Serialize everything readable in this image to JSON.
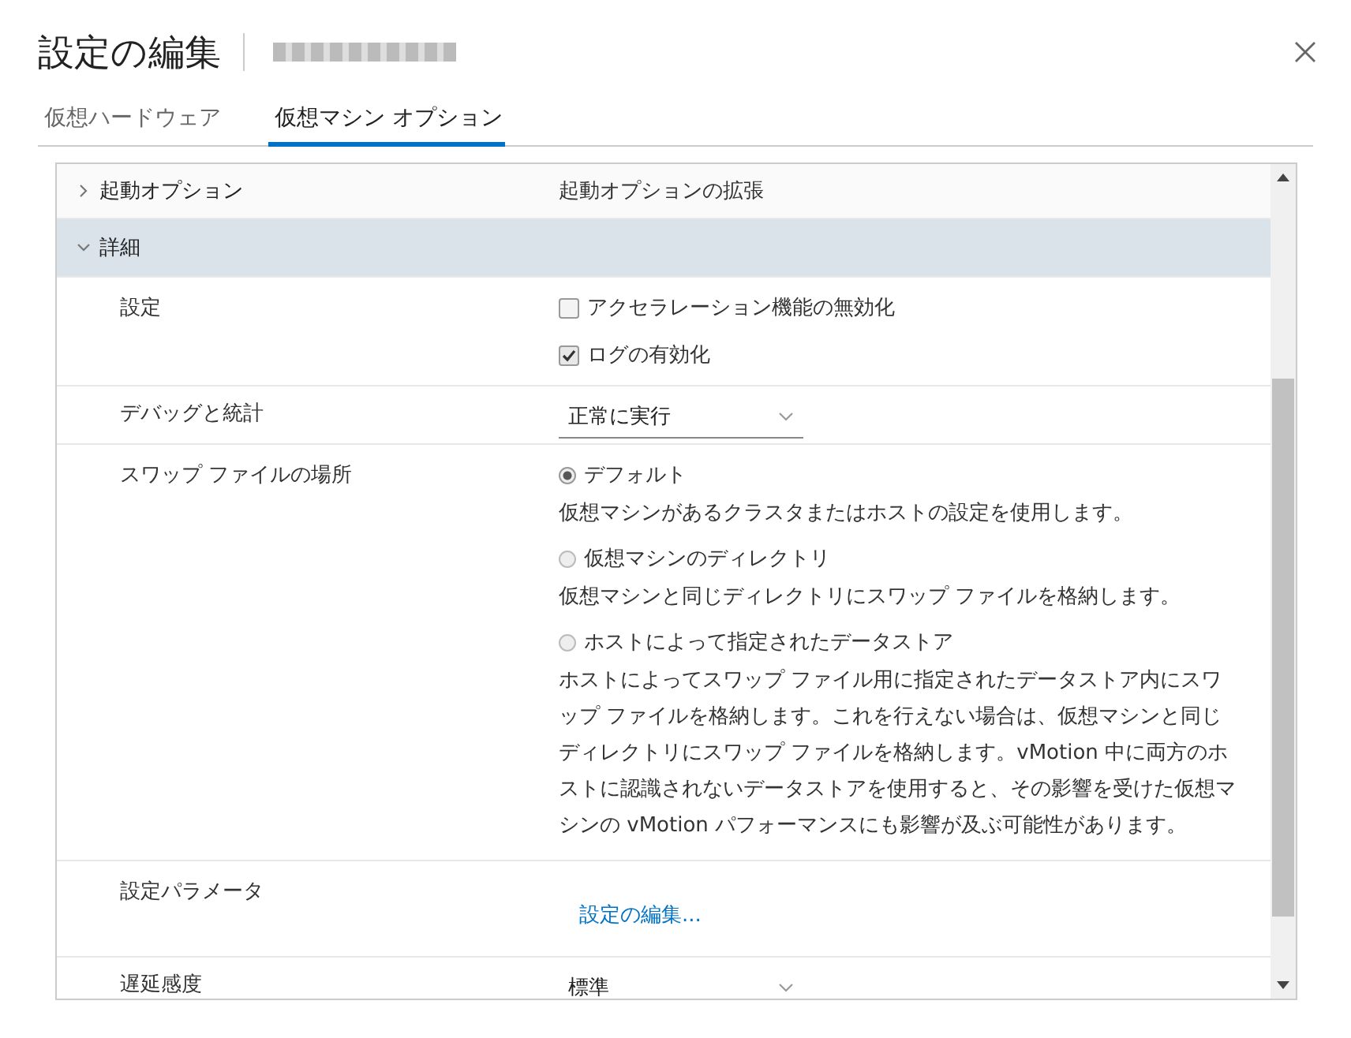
{
  "dialog": {
    "title": "設定の編集"
  },
  "tabs": [
    {
      "label": "仮想ハードウェア",
      "selected": false
    },
    {
      "label": "仮想マシン オプション",
      "selected": true
    }
  ],
  "sections": [
    {
      "label": "起動オプション",
      "value": "起動オプションの拡張",
      "expanded": false
    },
    {
      "label": "詳細",
      "expanded": true,
      "rows": [
        {
          "kind": "checkboxes",
          "label": "設定",
          "options": [
            {
              "label": "アクセラレーション機能の無効化",
              "checked": false
            },
            {
              "label": "ログの有効化",
              "checked": true
            }
          ]
        },
        {
          "kind": "select",
          "label": "デバッグと統計",
          "value": "正常に実行"
        },
        {
          "kind": "radios",
          "label": "スワップ ファイルの場所",
          "options": [
            {
              "label": "デフォルト",
              "description": "仮想マシンがあるクラスタまたはホストの設定を使用します。",
              "selected": true
            },
            {
              "label": "仮想マシンのディレクトリ",
              "description": "仮想マシンと同じディレクトリにスワップ ファイルを格納します。",
              "selected": false
            },
            {
              "label": "ホストによって指定されたデータストア",
              "description": "ホストによってスワップ ファイル用に指定されたデータストア内にスワップ ファイルを格納します。これを行えない場合は、仮想マシンと同じディレクトリにスワップ ファイルを格納します。vMotion 中に両方のホストに認識されないデータストアを使用すると、その影響を受けた仮想マシンの vMotion パフォーマンスにも影響が及ぶ可能性があります。",
              "selected": false
            }
          ]
        },
        {
          "kind": "link",
          "label": "設定パラメータ",
          "link": "設定の編集..."
        },
        {
          "kind": "select",
          "label": "遅延感度",
          "value": "標準"
        }
      ]
    }
  ]
}
